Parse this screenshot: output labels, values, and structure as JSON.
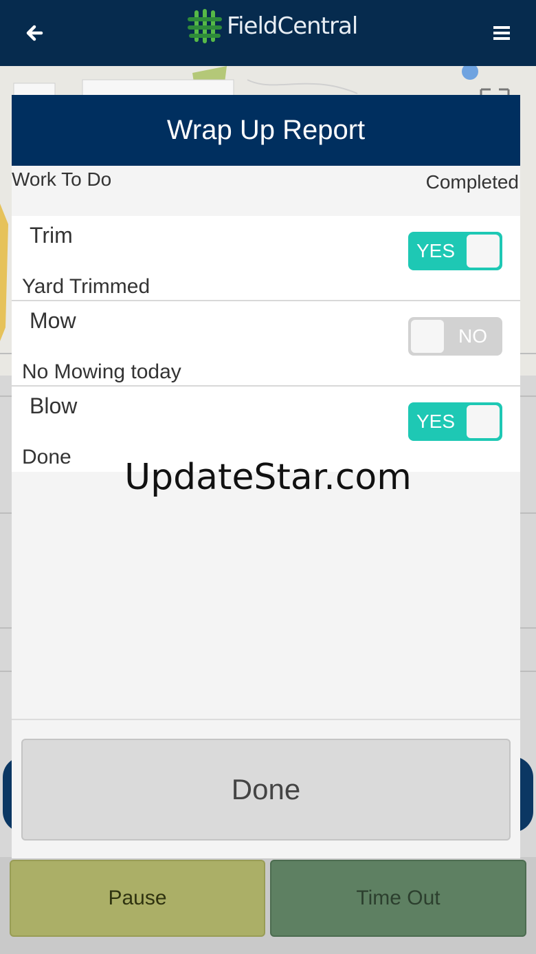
{
  "app": {
    "brand": "FieldCentral",
    "header_color": "#062b4e"
  },
  "modal": {
    "title": "Wrap Up Report",
    "col_work": "Work To Do",
    "col_completed": "Completed",
    "items": [
      {
        "name": "Trim",
        "note": "Yard Trimmed",
        "completed": true,
        "toggle_label": "YES"
      },
      {
        "name": "Mow",
        "note": "No Mowing today",
        "completed": false,
        "toggle_label": "NO"
      },
      {
        "name": "Blow",
        "note": "Done",
        "completed": true,
        "toggle_label": "YES"
      }
    ],
    "done_label": "Done",
    "accent": "#1ec8b4"
  },
  "watermark": "UpdateStar.com",
  "actions": {
    "pause_label": "Pause",
    "timeout_label": "Time Out",
    "pause_color": "#abaf67",
    "timeout_color": "#5e8062"
  },
  "icons": {
    "back": "arrow-left-icon",
    "menu": "hamburger-menu-icon",
    "logo": "fieldcentral-logo-icon"
  }
}
